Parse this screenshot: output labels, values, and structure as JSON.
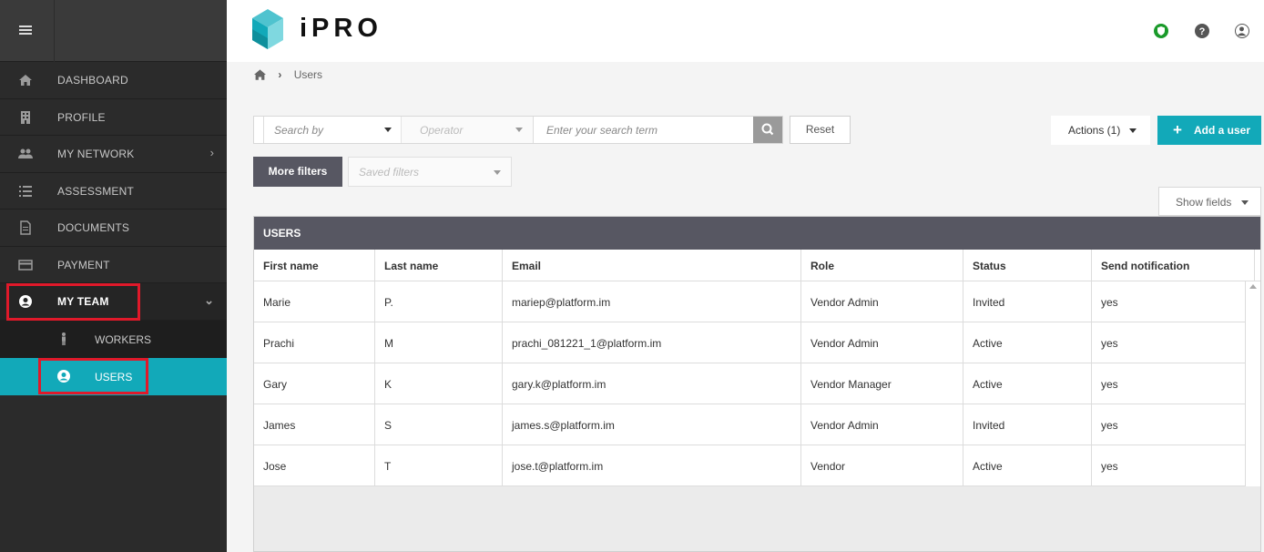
{
  "app": {
    "logo_text": "iPRO"
  },
  "sidebar": {
    "items": [
      {
        "label": "DASHBOARD",
        "icon": "home-icon"
      },
      {
        "label": "PROFILE",
        "icon": "building-icon"
      },
      {
        "label": "MY NETWORK",
        "icon": "users-icon"
      },
      {
        "label": "ASSESSMENT",
        "icon": "list-icon"
      },
      {
        "label": "DOCUMENTS",
        "icon": "document-icon"
      },
      {
        "label": "PAYMENT",
        "icon": "credit-card-icon"
      },
      {
        "label": "MY TEAM",
        "icon": "user-circle-icon"
      }
    ],
    "subitems": [
      {
        "label": "WORKERS",
        "icon": "person-icon"
      },
      {
        "label": "USERS",
        "icon": "user-circle-icon"
      }
    ]
  },
  "breadcrumb": {
    "current": "Users"
  },
  "filters": {
    "search_by_placeholder": "Search by",
    "operator_placeholder": "Operator",
    "term_placeholder": "Enter your search term",
    "reset_label": "Reset",
    "more_filters_label": "More filters",
    "saved_filters_placeholder": "Saved filters"
  },
  "toolbar": {
    "actions_label": "Actions (1)",
    "add_user_label": "Add a user",
    "show_fields_label": "Show fields"
  },
  "table": {
    "title": "USERS",
    "columns": [
      "First name",
      "Last name",
      "Email",
      "Role",
      "Status",
      "Send notification"
    ],
    "rows": [
      [
        "Marie",
        "P.",
        "mariep@platform.im",
        "Vendor Admin",
        "Invited",
        "yes"
      ],
      [
        "Prachi",
        "M",
        "prachi_081221_1@platform.im",
        "Vendor Admin",
        "Active",
        "yes"
      ],
      [
        "Gary",
        "K",
        "gary.k@platform.im",
        "Vendor Manager",
        "Active",
        "yes"
      ],
      [
        "James",
        "S",
        "james.s@platform.im",
        "Vendor Admin",
        "Invited",
        "yes"
      ],
      [
        "Jose",
        "T",
        "jose.t@platform.im",
        "Vendor",
        "Active",
        "yes"
      ]
    ]
  },
  "colors": {
    "accent": "#12a9b9",
    "sidebar_bg": "#2b2b2b",
    "table_header_bg": "#575762",
    "highlight": "#e0192a",
    "status_badge": "#1a9a2a"
  }
}
